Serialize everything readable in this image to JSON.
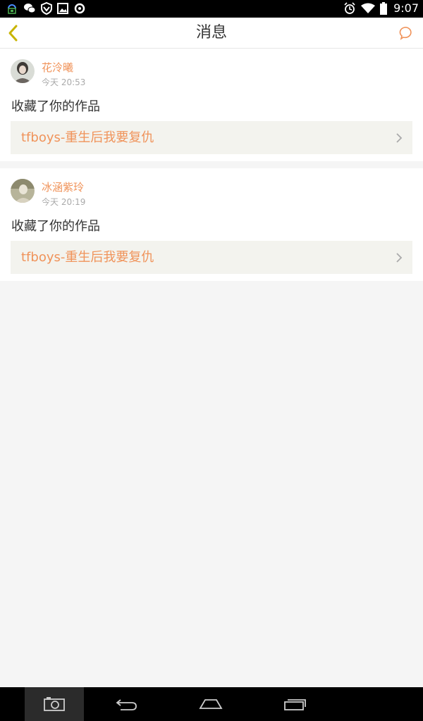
{
  "status_bar": {
    "time": "9:07",
    "left_icons": [
      "android-debug-icon",
      "wechat-icon",
      "vpn-shield-icon",
      "image-icon",
      "sync-icon"
    ],
    "right_icons": [
      "alarm-icon",
      "wifi-icon",
      "battery-icon"
    ]
  },
  "header": {
    "title": "消息",
    "back_icon": "chevron-left-icon",
    "chat_icon": "chat-bubble-icon",
    "accent_color": "#c8b400",
    "chat_color": "#f0935a"
  },
  "messages": [
    {
      "username": "花泠曦",
      "time": "今天 20:53",
      "action": "收藏了你的作品",
      "work_title": "tfboys-重生后我要复仇"
    },
    {
      "username": "冰涵紫玲",
      "time": "今天 20:19",
      "action": "收藏了你的作品",
      "work_title": "tfboys-重生后我要复仇"
    }
  ],
  "colors": {
    "username": "#f0935a",
    "link_background": "#f3f3ee",
    "page_background": "#f5f5f5"
  },
  "nav_bar": {
    "buttons": [
      "screenshot-icon",
      "back-icon",
      "home-icon",
      "recents-icon"
    ]
  }
}
